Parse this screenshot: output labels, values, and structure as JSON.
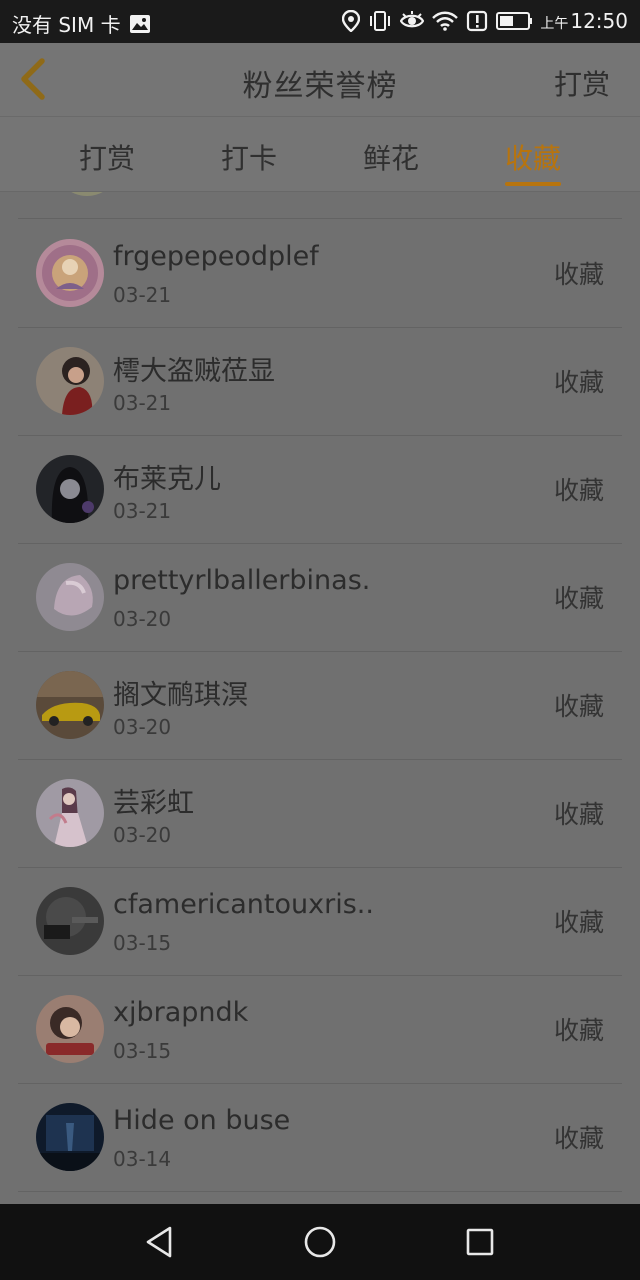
{
  "status_bar": {
    "carrier": "没有 SIM 卡",
    "time_prefix": "上午",
    "time": "12:50",
    "icons": [
      "image-icon",
      "location-icon",
      "vibrate-icon",
      "eye-icon",
      "wifi-icon",
      "alert-icon",
      "battery-icon"
    ]
  },
  "header": {
    "title": "粉丝荣誉榜",
    "action_label": "打赏",
    "back_icon": "chevron-left-icon",
    "accent_color": "#b7740e"
  },
  "tabs": [
    {
      "label": "打赏",
      "active": false
    },
    {
      "label": "打卡",
      "active": false
    },
    {
      "label": "鲜花",
      "active": false
    },
    {
      "label": "收藏",
      "active": true
    }
  ],
  "list": {
    "rows": [
      {
        "name": "frgepepeodplef",
        "date": "03-21",
        "action": "收藏"
      },
      {
        "name": "樗大盗贼莅显",
        "date": "03-21",
        "action": "收藏"
      },
      {
        "name": "布莱克儿",
        "date": "03-21",
        "action": "收藏"
      },
      {
        "name": "prettyrlballerbinas...",
        "date": "03-20",
        "action": "收藏"
      },
      {
        "name": "搁文鸸琪溟",
        "date": "03-20",
        "action": "收藏"
      },
      {
        "name": "芸彩虹",
        "date": "03-20",
        "action": "收藏"
      },
      {
        "name": "cfamericantouxris...",
        "date": "03-15",
        "action": "收藏"
      },
      {
        "name": "xjbrapndk",
        "date": "03-15",
        "action": "收藏"
      },
      {
        "name": "Hide on buse",
        "date": "03-14",
        "action": "收藏"
      }
    ]
  },
  "nav_bar": {
    "icons": [
      "back-triangle-icon",
      "home-circle-icon",
      "recents-square-icon"
    ]
  }
}
